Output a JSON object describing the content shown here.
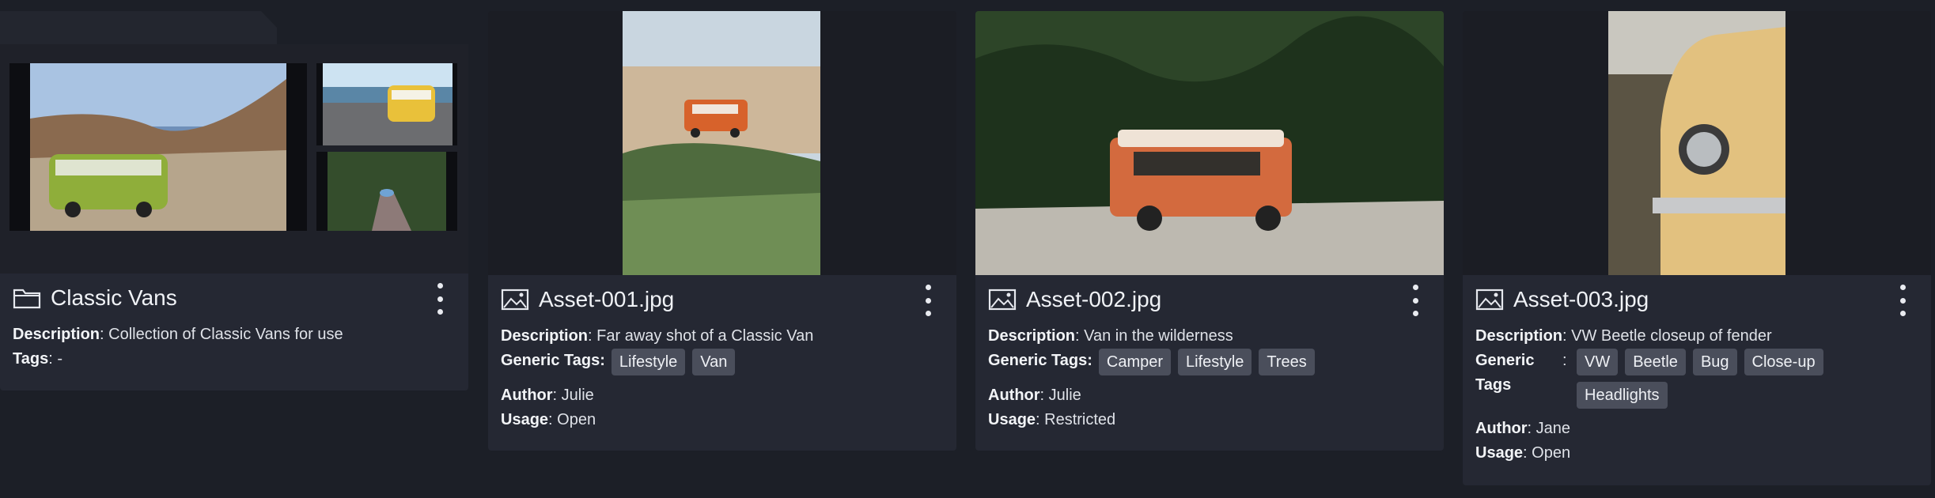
{
  "folder": {
    "title": "Classic Vans",
    "description_label": "Description",
    "description": ": Collection of Classic Vans for use",
    "tags_label": "Tags",
    "tags_value": ": -"
  },
  "assets": [
    {
      "title": "Asset-001.jpg",
      "description_label": "Description",
      "description": ": Far away shot of a Classic Van",
      "tags_label": "Generic Tags:",
      "tags": [
        "Lifestyle",
        "Van"
      ],
      "author_label": "Author",
      "author": ": Julie",
      "usage_label": "Usage",
      "usage": ": Open"
    },
    {
      "title": "Asset-002.jpg",
      "description_label": "Description",
      "description": ": Van in the wilderness",
      "tags_label": "Generic Tags:",
      "tags": [
        "Camper",
        "Lifestyle",
        "Trees"
      ],
      "author_label": "Author",
      "author": ": Julie",
      "usage_label": "Usage",
      "usage": ": Restricted"
    },
    {
      "title": "Asset-003.jpg",
      "description_label": "Description",
      "description": ": VW Beetle closeup of fender",
      "tags_label_line1": "Generic",
      "tags_label_line2": "Tags",
      "tags_colon": ":",
      "tags": [
        "VW",
        "Beetle",
        "Bug",
        "Close-up",
        "Headlights"
      ],
      "author_label": "Author",
      "author": ": Jane",
      "usage_label": "Usage",
      "usage": ": Open"
    }
  ],
  "icons": {
    "folder": "folder-icon",
    "image": "image-icon",
    "menu": "more-vertical-icon"
  },
  "colors": {
    "background": "#1c1f27",
    "card": "#252833",
    "tag": "#4a4e5b"
  }
}
